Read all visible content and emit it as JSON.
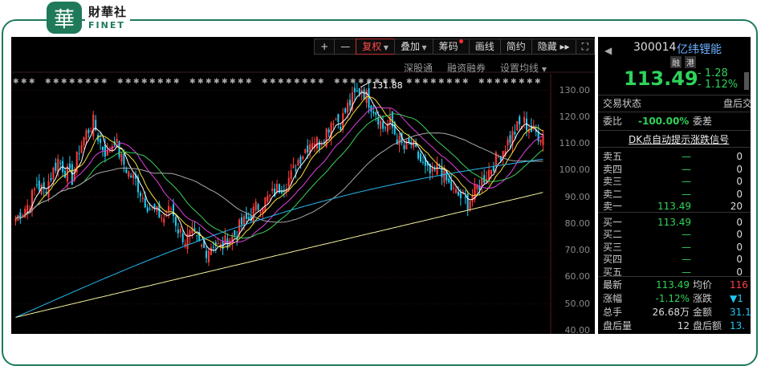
{
  "brand": {
    "logo_char": "華",
    "name_cn": "財華社",
    "name_en": "FINET"
  },
  "toolbar": {
    "buttons": [
      {
        "label": "+"
      },
      {
        "label": "—"
      },
      {
        "label": "复权",
        "active": true,
        "caret": true
      },
      {
        "label": "叠加",
        "caret": true
      },
      {
        "label": "筹码",
        "dot": true
      },
      {
        "label": "画线"
      },
      {
        "label": "简约"
      },
      {
        "label": "隐藏 ▸▸"
      },
      {
        "label": "⛶"
      }
    ],
    "sub": [
      "深股通",
      "融资融券",
      "设置均线"
    ]
  },
  "chart": {
    "peak_label": "131.88",
    "y_ticks": [
      "130.00",
      "120.00",
      "110.00",
      "100.00",
      "90.00",
      "80.00",
      "70.00",
      "60.00",
      "50.00",
      "40.00"
    ]
  },
  "chart_data": {
    "type": "candlestick",
    "ylim": [
      40,
      135
    ],
    "yticks": [
      130,
      120,
      110,
      100,
      90,
      80,
      70,
      60,
      50,
      40
    ],
    "max_marker": 131.88,
    "closes": [
      82,
      85,
      88,
      95,
      92,
      98,
      104,
      100,
      97,
      108,
      114,
      118,
      110,
      106,
      112,
      104,
      99,
      96,
      90,
      86,
      84,
      82,
      86,
      78,
      74,
      76,
      72,
      70,
      73,
      71,
      74,
      76,
      80,
      82,
      86,
      88,
      90,
      93,
      95,
      98,
      104,
      108,
      112,
      110,
      115,
      120,
      118,
      124,
      128,
      131,
      126,
      122,
      116,
      118,
      112,
      108,
      110,
      105,
      100,
      98,
      102,
      96,
      92,
      90,
      88,
      92,
      96,
      100,
      104,
      108,
      112,
      116,
      118,
      115,
      113.49
    ]
  },
  "stock": {
    "code": "300014",
    "name": "亿纬锂能",
    "tags": [
      "融",
      "港"
    ],
    "price": "113.49",
    "change": "- 1.28",
    "change_pct": "- 1.12%"
  },
  "status": {
    "trade_state_label": "交易状态",
    "trade_state_value": "盘后交",
    "wei_bi_label": "委比",
    "wei_bi_value": "-100.00%",
    "wei_cha_label": "委差",
    "signal_link": "DK点自动提示涨跌信号"
  },
  "order_book": {
    "sell": [
      {
        "label": "卖五",
        "price": "—",
        "vol": "0"
      },
      {
        "label": "卖四",
        "price": "—",
        "vol": "0"
      },
      {
        "label": "卖三",
        "price": "—",
        "vol": "0"
      },
      {
        "label": "卖二",
        "price": "—",
        "vol": "0"
      },
      {
        "label": "卖一",
        "price": "113.49",
        "vol": "20"
      }
    ],
    "buy": [
      {
        "label": "买一",
        "price": "113.49",
        "vol": "0"
      },
      {
        "label": "买二",
        "price": "—",
        "vol": "0"
      },
      {
        "label": "买三",
        "price": "—",
        "vol": "0"
      },
      {
        "label": "买四",
        "price": "—",
        "vol": "0"
      },
      {
        "label": "买五",
        "price": "—",
        "vol": "0"
      }
    ]
  },
  "quote": {
    "latest_label": "最新",
    "latest": "113.49",
    "avg_label": "均价",
    "avg": "116",
    "chg_label": "涨幅",
    "chg": "-1.12%",
    "updown_label": "涨跌",
    "updown": "▼1",
    "vol_label": "总手",
    "vol": "26.68万",
    "amt_label": "金额",
    "amt": "31.1",
    "after_vol_label": "盘后量",
    "after_vol": "12",
    "after_amt_label": "盘后额",
    "after_amt": "13."
  }
}
